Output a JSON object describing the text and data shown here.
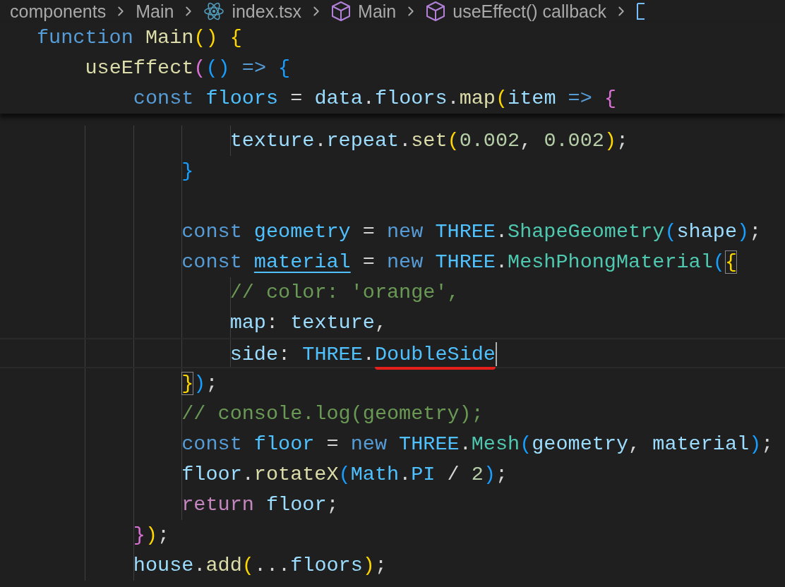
{
  "breadcrumb": [
    {
      "label": "components",
      "kind": "folder"
    },
    {
      "label": "Main",
      "kind": "folder"
    },
    {
      "label": "index.tsx",
      "kind": "file"
    },
    {
      "label": "Main",
      "kind": "function"
    },
    {
      "label": "useEffect() callback",
      "kind": "function"
    },
    {
      "kind": "variable"
    }
  ],
  "sticky_lines": [
    {
      "tokens": [
        {
          "t": "function ",
          "kind": "kw"
        },
        {
          "t": "Main",
          "kind": "fn"
        },
        {
          "t": "()",
          "kind": "b1"
        },
        {
          "t": " {",
          "kind": "b1"
        }
      ]
    },
    {
      "tokens": [
        {
          "t": "    useEffect",
          "kind": "fn"
        },
        {
          "t": "(",
          "kind": "b2"
        },
        {
          "t": "()",
          "kind": "b3"
        },
        {
          "t": " => ",
          "kind": "kw"
        },
        {
          "t": "{",
          "kind": "b3"
        }
      ]
    },
    {
      "tokens": [
        {
          "t": "        const ",
          "kind": "kw"
        },
        {
          "t": "floors",
          "kind": "const"
        },
        {
          "t": " = ",
          "kind": "punct"
        },
        {
          "t": "data",
          "kind": "var"
        },
        {
          "t": ".",
          "kind": "punct"
        },
        {
          "t": "floors",
          "kind": "var"
        },
        {
          "t": ".",
          "kind": "punct"
        },
        {
          "t": "map",
          "kind": "fn"
        },
        {
          "t": "(",
          "kind": "b1"
        },
        {
          "t": "item",
          "kind": "var"
        },
        {
          "t": " => ",
          "kind": "kw"
        },
        {
          "t": "{",
          "kind": "b2"
        }
      ]
    }
  ],
  "lines": [
    {
      "tokens": [
        {
          "t": "                texture",
          "kind": "var"
        },
        {
          "t": ".",
          "kind": "punct"
        },
        {
          "t": "repeat",
          "kind": "var"
        },
        {
          "t": ".",
          "kind": "punct"
        },
        {
          "t": "set",
          "kind": "fn"
        },
        {
          "t": "(",
          "kind": "b1"
        },
        {
          "t": "0.002",
          "kind": "num"
        },
        {
          "t": ", ",
          "kind": "punct"
        },
        {
          "t": "0.002",
          "kind": "num"
        },
        {
          "t": ")",
          "kind": "b1"
        },
        {
          "t": ";",
          "kind": "punct"
        }
      ],
      "current": false
    },
    {
      "tokens": [
        {
          "t": "            }",
          "kind": "b3"
        }
      ],
      "current": false
    },
    {
      "kind": "blank"
    },
    {
      "tokens": [
        {
          "t": "            const ",
          "kind": "kw"
        },
        {
          "t": "geometry",
          "kind": "const"
        },
        {
          "t": " = ",
          "kind": "punct"
        },
        {
          "t": "new ",
          "kind": "kw"
        },
        {
          "t": "THREE",
          "kind": "const"
        },
        {
          "t": ".",
          "kind": "punct"
        },
        {
          "t": "ShapeGeometry",
          "kind": "cls"
        },
        {
          "t": "(",
          "kind": "b3"
        },
        {
          "t": "shape",
          "kind": "var"
        },
        {
          "t": ")",
          "kind": "b3"
        },
        {
          "t": ";",
          "kind": "punct"
        }
      ],
      "current": false
    },
    {
      "tokens": [
        {
          "t": "            const ",
          "kind": "kw"
        },
        {
          "t": "material",
          "kind": "const",
          "underline": true
        },
        {
          "t": " = ",
          "kind": "punct"
        },
        {
          "t": "new ",
          "kind": "kw"
        },
        {
          "t": "THREE",
          "kind": "const"
        },
        {
          "t": ".",
          "kind": "punct"
        },
        {
          "t": "MeshPhongMaterial",
          "kind": "cls"
        },
        {
          "t": "(",
          "kind": "b3"
        },
        {
          "t": "{",
          "kind": "b1",
          "match": true
        }
      ],
      "current": false
    },
    {
      "tokens": [
        {
          "t": "                // color: 'orange',",
          "kind": "comment"
        }
      ],
      "current": false
    },
    {
      "tokens": [
        {
          "t": "                map",
          "kind": "var"
        },
        {
          "t": ": ",
          "kind": "punct"
        },
        {
          "t": "texture",
          "kind": "var"
        },
        {
          "t": ",",
          "kind": "punct"
        }
      ],
      "current": false
    },
    {
      "tokens": [
        {
          "t": "                side",
          "kind": "var"
        },
        {
          "t": ": ",
          "kind": "punct"
        },
        {
          "t": "THREE",
          "kind": "const"
        },
        {
          "t": ".",
          "kind": "punct"
        },
        {
          "t": "DoubleSide",
          "kind": "const",
          "marked": true
        }
      ],
      "current": true
    },
    {
      "tokens": [
        {
          "t": "            }",
          "kind": "b1",
          "match": true
        },
        {
          "t": ")",
          "kind": "b3"
        },
        {
          "t": ";",
          "kind": "punct"
        }
      ],
      "current": false
    },
    {
      "tokens": [
        {
          "t": "            // console.log(geometry);",
          "kind": "comment"
        }
      ],
      "current": false
    },
    {
      "tokens": [
        {
          "t": "            const ",
          "kind": "kw"
        },
        {
          "t": "floor",
          "kind": "const"
        },
        {
          "t": " = ",
          "kind": "punct"
        },
        {
          "t": "new ",
          "kind": "kw"
        },
        {
          "t": "THREE",
          "kind": "const"
        },
        {
          "t": ".",
          "kind": "punct"
        },
        {
          "t": "Mesh",
          "kind": "cls"
        },
        {
          "t": "(",
          "kind": "b3"
        },
        {
          "t": "geometry",
          "kind": "var"
        },
        {
          "t": ", ",
          "kind": "punct"
        },
        {
          "t": "material",
          "kind": "var"
        },
        {
          "t": ")",
          "kind": "b3"
        },
        {
          "t": ";",
          "kind": "punct"
        }
      ],
      "current": false
    },
    {
      "tokens": [
        {
          "t": "            floor",
          "kind": "var"
        },
        {
          "t": ".",
          "kind": "punct"
        },
        {
          "t": "rotateX",
          "kind": "fn"
        },
        {
          "t": "(",
          "kind": "b3"
        },
        {
          "t": "Math",
          "kind": "const"
        },
        {
          "t": ".",
          "kind": "punct"
        },
        {
          "t": "PI",
          "kind": "const"
        },
        {
          "t": " / ",
          "kind": "punct"
        },
        {
          "t": "2",
          "kind": "num"
        },
        {
          "t": ")",
          "kind": "b3"
        },
        {
          "t": ";",
          "kind": "punct"
        }
      ],
      "current": false
    },
    {
      "tokens": [
        {
          "t": "            return ",
          "kind": "ctrl"
        },
        {
          "t": "floor",
          "kind": "var"
        },
        {
          "t": ";",
          "kind": "punct"
        }
      ],
      "current": false
    },
    {
      "tokens": [
        {
          "t": "        }",
          "kind": "b2"
        },
        {
          "t": ")",
          "kind": "b1"
        },
        {
          "t": ";",
          "kind": "punct"
        }
      ],
      "current": false
    },
    {
      "tokens": [
        {
          "t": "        house",
          "kind": "var"
        },
        {
          "t": ".",
          "kind": "punct"
        },
        {
          "t": "add",
          "kind": "fn"
        },
        {
          "t": "(",
          "kind": "b1"
        },
        {
          "t": "...",
          "kind": "punct"
        },
        {
          "t": "floors",
          "kind": "var"
        },
        {
          "t": ")",
          "kind": "b1"
        },
        {
          "t": ";",
          "kind": "punct"
        }
      ],
      "current": false
    }
  ]
}
